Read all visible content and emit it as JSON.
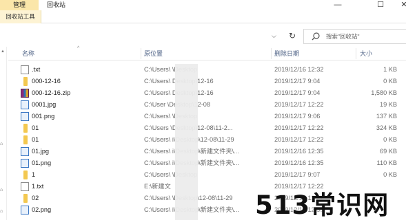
{
  "ribbon": {
    "manage_tab": "管理",
    "window_tab": "回收站",
    "tools_label": "回收站工具",
    "minimize": "—",
    "maximize": "☐",
    "close": "✕"
  },
  "address": {
    "dropdown": "⌵",
    "refresh": "↻",
    "search_placeholder": "搜索\"回收站\""
  },
  "columns": {
    "name": "名称",
    "location": "原位置",
    "deleted": "删除日期",
    "size": "大小"
  },
  "files": [
    {
      "icon": "text-file-icon",
      "name": ".txt",
      "location": "C:\\Users\\          \\Desktop",
      "deleted": "2019/12/16 12:32",
      "size": "1 KB"
    },
    {
      "icon": "folder-icon",
      "name": "000-12-16",
      "location": "C:\\Users\\          Desktop\\12-16",
      "deleted": "2019/12/17 9:04",
      "size": "0 KB"
    },
    {
      "icon": "zip-icon",
      "name": "000-12-16.zip",
      "location": "C:\\Users\\          Desktop\\12-16",
      "deleted": "2019/12/17 9:04",
      "size": "1,580 KB"
    },
    {
      "icon": "image-icon",
      "name": "0001.jpg",
      "location": "C:\\User          \\Desktop\\12-08",
      "deleted": "2019/12/17 12:22",
      "size": "19 KB"
    },
    {
      "icon": "image-icon",
      "name": "001.png",
      "location": "C:\\Users\\          \\Desktop",
      "deleted": "2019/12/17 9:06",
      "size": "137 KB"
    },
    {
      "icon": "folder-icon",
      "name": "01",
      "location": "C:\\Users          \\Desktop\\12-08\\11-2...",
      "deleted": "2019/12/17 12:22",
      "size": "324 KB"
    },
    {
      "icon": "folder-icon",
      "name": "01",
      "location": "C:\\Users\\          i\\Desktop\\12-08\\11-29",
      "deleted": "2019/12/17 12:22",
      "size": "0 KB"
    },
    {
      "icon": "image-icon",
      "name": "01.jpg",
      "location": "C:\\Users\\          i\\Desktop\\新建文件夹\\...",
      "deleted": "2019/12/16 12:35",
      "size": "69 KB"
    },
    {
      "icon": "image-icon",
      "name": "01.png",
      "location": "C:\\Users\\          i\\Desktop\\新建文件夹\\...",
      "deleted": "2019/12/16 12:35",
      "size": "110 KB"
    },
    {
      "icon": "folder-icon",
      "name": "1",
      "location": "C:\\Users\\          \\Desktop",
      "deleted": "2019/12/17 9:07",
      "size": "0 KB"
    },
    {
      "icon": "text-file-icon",
      "name": "1.txt",
      "location": "E:\\新建文",
      "deleted": "2019/12/17 12:22",
      "size": ""
    },
    {
      "icon": "folder-icon",
      "name": "02",
      "location": "C:\\Users\\          \\Desktop\\12-08\\11-29",
      "deleted": "2019/12/17 12:22",
      "size": ""
    },
    {
      "icon": "image-icon",
      "name": "02.png",
      "location": "C:\\Users\\          i\\Desktop\\新建文件夹\\...",
      "deleted": "2019/12/16 12:35",
      "size": ""
    }
  ],
  "watermark": "513常识网"
}
